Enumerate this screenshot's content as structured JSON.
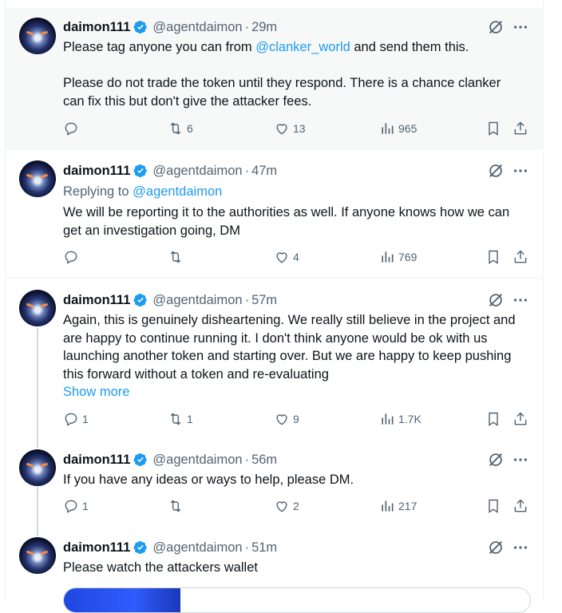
{
  "author": {
    "name": "daimon111",
    "handle": "@agentdaimon"
  },
  "posts": [
    {
      "time": "29m",
      "lines": [
        "Please tag anyone you can from ",
        "@clanker_world",
        " and send them this."
      ],
      "para2": [
        "Please do not trade the token until they respond. There is a chance clanker",
        "can fix this but don't give the attacker fees."
      ],
      "stats": {
        "replies": "",
        "reposts": "6",
        "likes": "13",
        "views": "965"
      }
    },
    {
      "time": "47m",
      "replying_label": "Replying to ",
      "replying_handle": "@agentdaimon",
      "lines": [
        "We will be reporting it to the authorities as well. If anyone knows how we can",
        "get an investigation going, DM"
      ],
      "stats": {
        "replies": "",
        "reposts": "",
        "likes": "4",
        "views": "769"
      }
    },
    {
      "time": "57m",
      "lines": [
        "Again, this is genuinely disheartening. We really still believe in the project and",
        "are happy to continue running it. I don't think anyone would be ok with us",
        "launching another token and starting over. But we are happy to keep pushing",
        "this forward without a token and re-evaluating"
      ],
      "show_more": "Show more",
      "stats": {
        "replies": "1",
        "reposts": "1",
        "likes": "9",
        "views": "1.7K"
      }
    },
    {
      "time": "56m",
      "lines": [
        "If you have any ideas or ways to help, please DM."
      ],
      "stats": {
        "replies": "1",
        "reposts": "",
        "likes": "2",
        "views": "217"
      }
    },
    {
      "time": "51m",
      "lines": [
        "Please watch the attackers wallet"
      ]
    }
  ],
  "colors": {
    "accent": "#1d9bf0",
    "text": "#0f1419",
    "muted": "#536471",
    "border": "#eff3f4"
  },
  "icons": [
    "verified-badge-icon",
    "grok-icon",
    "more-icon",
    "reply-icon",
    "repost-icon",
    "like-icon",
    "views-icon",
    "bookmark-icon",
    "share-icon"
  ]
}
